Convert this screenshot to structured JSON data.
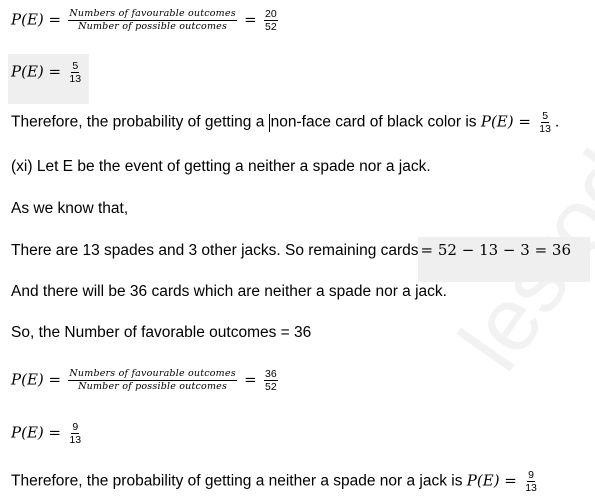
{
  "eq1": {
    "lhs": "P(E) =",
    "numerator": "Numbers of favourable outcomes",
    "denominator": "Number of possible outcomes",
    "eq": "=",
    "result_num": "20",
    "result_den": "52"
  },
  "eq2": {
    "lhs": "P(E) =",
    "num": "5",
    "den": "13"
  },
  "conclusion1": {
    "text_before_cursor": "Therefore, the probability of getting a ",
    "text_after_cursor": "non-face card of black color is ",
    "math": "P(E) =",
    "num": "5",
    "den": "13",
    "trail": "."
  },
  "part_xi": "(xi) Let E be the event of getting a neither a spade nor a jack.",
  "as_we_know": "As we know that,",
  "remaining": {
    "text": "There are 13 spades and 3 other jacks. So remaining cards",
    "expr": "=  52 − 13 − 3  =  36"
  },
  "statement": "And there will be 36 cards which are neither a spade nor a jack.",
  "favorable": "So, the Number of favorable outcomes = 36",
  "eq3": {
    "lhs": "P(E) =",
    "numerator": "Numbers of favourable outcomes",
    "denominator": "Number of possible outcomes",
    "eq": "=",
    "result_num": "36",
    "result_den": "52"
  },
  "eq4": {
    "lhs": "P(E)  =",
    "num": "9",
    "den": "13"
  },
  "conclusion2": {
    "text": "Therefore, the probability of getting a neither a spade nor a jack is ",
    "math": "P(E)  =",
    "num": "9",
    "den": "13"
  },
  "watermark": "lestod"
}
